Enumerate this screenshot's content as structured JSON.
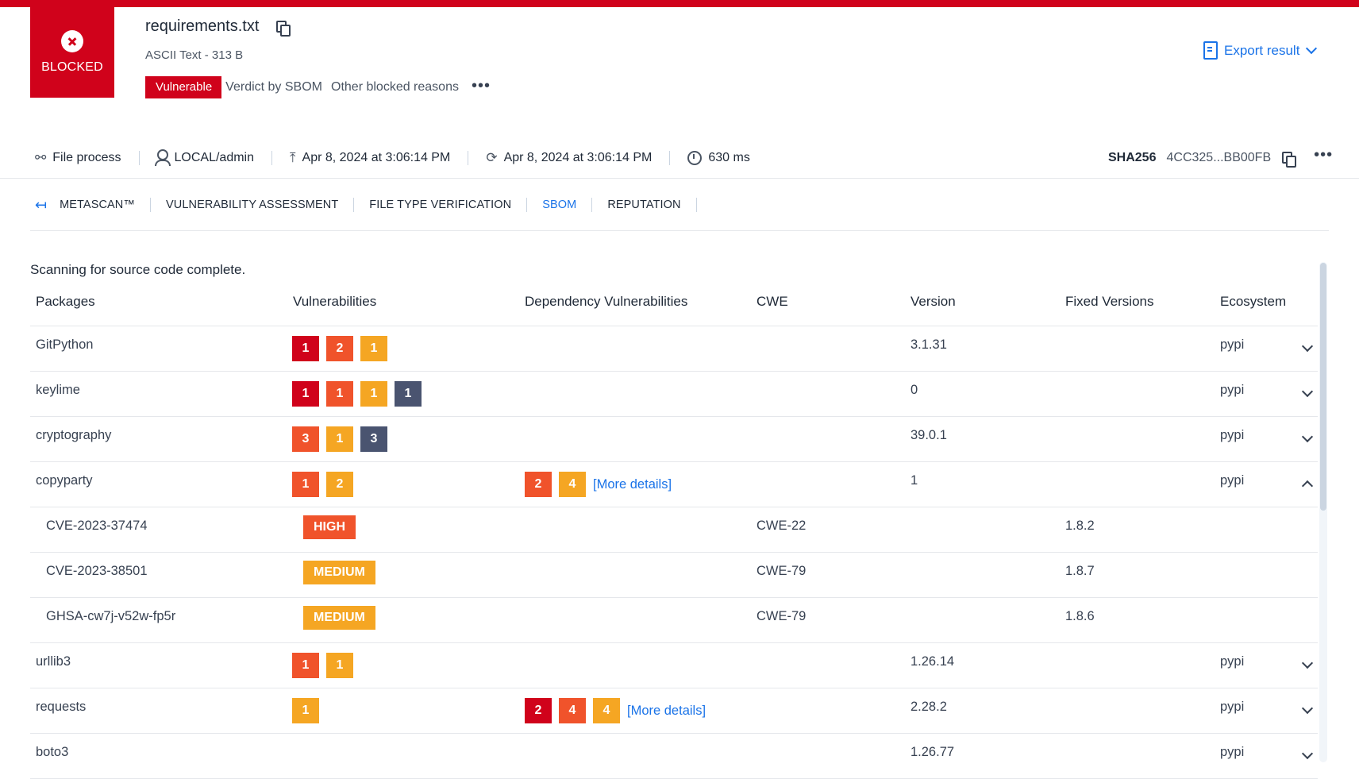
{
  "colors": {
    "brand_red": "#d0021b",
    "critical": "#d0021b",
    "high": "#f0532b",
    "medium": "#f5a623",
    "low": "#4a5470",
    "link": "#1a73e8"
  },
  "header": {
    "status_label": "BLOCKED",
    "file_name": "requirements.txt",
    "file_type": "ASCII Text - 313 B",
    "verdict_badge": "Vulnerable",
    "verdict_source": "Verdict by SBOM",
    "other_reasons": "Other blocked reasons",
    "more_icon": "more-horizontal-icon",
    "export_label": "Export result"
  },
  "meta": {
    "process": "File process",
    "user": "LOCAL/admin",
    "upload_time": "Apr 8, 2024 at 3:06:14 PM",
    "process_time": "Apr 8, 2024 at 3:06:14 PM",
    "duration": "630 ms",
    "sha_label": "SHA256",
    "sha_value": "4CC325...BB00FB"
  },
  "tabs": [
    "METASCAN™",
    "VULNERABILITY ASSESSMENT",
    "FILE TYPE VERIFICATION",
    "SBOM",
    "REPUTATION"
  ],
  "active_tab": "SBOM",
  "scan_status": "Scanning for source code complete.",
  "table": {
    "headers": {
      "packages": "Packages",
      "vulnerabilities": "Vulnerabilities",
      "dependency": "Dependency Vulnerabilities",
      "cwe": "CWE",
      "version": "Version",
      "fixed": "Fixed Versions",
      "ecosystem": "Ecosystem"
    },
    "rows": [
      {
        "type": "pkg",
        "name": "GitPython",
        "vulns": [
          {
            "n": "1",
            "sev": "critical"
          },
          {
            "n": "2",
            "sev": "high"
          },
          {
            "n": "1",
            "sev": "medium"
          }
        ],
        "dep": [],
        "dep_link": "",
        "version": "3.1.31",
        "ecosystem": "pypi",
        "expanded": false
      },
      {
        "type": "pkg",
        "name": "keylime",
        "vulns": [
          {
            "n": "1",
            "sev": "critical"
          },
          {
            "n": "1",
            "sev": "high"
          },
          {
            "n": "1",
            "sev": "medium"
          },
          {
            "n": "1",
            "sev": "low"
          }
        ],
        "dep": [],
        "dep_link": "",
        "version": "0",
        "ecosystem": "pypi",
        "expanded": false
      },
      {
        "type": "pkg",
        "name": "cryptography",
        "vulns": [
          {
            "n": "3",
            "sev": "high"
          },
          {
            "n": "1",
            "sev": "medium"
          },
          {
            "n": "3",
            "sev": "low"
          }
        ],
        "dep": [],
        "dep_link": "",
        "version": "39.0.1",
        "ecosystem": "pypi",
        "expanded": false
      },
      {
        "type": "pkg",
        "name": "copyparty",
        "vulns": [
          {
            "n": "1",
            "sev": "high"
          },
          {
            "n": "2",
            "sev": "medium"
          }
        ],
        "dep": [
          {
            "n": "2",
            "sev": "high"
          },
          {
            "n": "4",
            "sev": "medium"
          }
        ],
        "dep_link": "[More details]",
        "version": "1",
        "ecosystem": "pypi",
        "expanded": true
      },
      {
        "type": "cve",
        "name": "CVE-2023-37474",
        "severity": "HIGH",
        "sev": "high",
        "cwe": "CWE-22",
        "fixed": "1.8.2"
      },
      {
        "type": "cve",
        "name": "CVE-2023-38501",
        "severity": "MEDIUM",
        "sev": "medium",
        "cwe": "CWE-79",
        "fixed": "1.8.7"
      },
      {
        "type": "cve",
        "name": "GHSA-cw7j-v52w-fp5r",
        "severity": "MEDIUM",
        "sev": "medium",
        "cwe": "CWE-79",
        "fixed": "1.8.6"
      },
      {
        "type": "pkg",
        "name": "urllib3",
        "vulns": [
          {
            "n": "1",
            "sev": "high"
          },
          {
            "n": "1",
            "sev": "medium"
          }
        ],
        "dep": [],
        "dep_link": "",
        "version": "1.26.14",
        "ecosystem": "pypi",
        "expanded": false
      },
      {
        "type": "pkg",
        "name": "requests",
        "vulns": [
          {
            "n": "1",
            "sev": "medium"
          }
        ],
        "dep": [
          {
            "n": "2",
            "sev": "critical"
          },
          {
            "n": "4",
            "sev": "high"
          },
          {
            "n": "4",
            "sev": "medium"
          }
        ],
        "dep_link": "[More details]",
        "version": "2.28.2",
        "ecosystem": "pypi",
        "expanded": false
      },
      {
        "type": "pkg",
        "name": "boto3",
        "vulns": [],
        "dep": [],
        "dep_link": "",
        "version": "1.26.77",
        "ecosystem": "pypi",
        "expanded": false
      }
    ]
  }
}
